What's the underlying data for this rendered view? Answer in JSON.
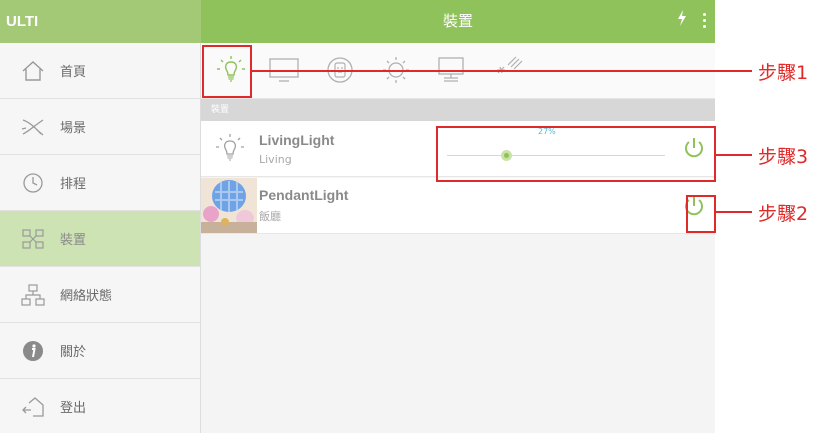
{
  "app": {
    "brand": "ULTI",
    "title": "裝置"
  },
  "topbar": {
    "flash_icon": "flash-icon",
    "more_icon": "more-vert-icon"
  },
  "sidebar": {
    "items": [
      {
        "label": "首頁",
        "icon": "home-icon"
      },
      {
        "label": "場景",
        "icon": "scene-icon"
      },
      {
        "label": "排程",
        "icon": "clock-icon"
      },
      {
        "label": "裝置",
        "icon": "devices-icon",
        "active": true
      },
      {
        "label": "網絡狀態",
        "icon": "network-icon"
      },
      {
        "label": "關於",
        "icon": "info-icon"
      },
      {
        "label": "登出",
        "icon": "logout-icon"
      }
    ]
  },
  "categories": [
    {
      "name": "light",
      "icon": "bulb-icon",
      "selected": true
    },
    {
      "name": "tv",
      "icon": "tv-icon"
    },
    {
      "name": "socket",
      "icon": "socket-icon"
    },
    {
      "name": "sun",
      "icon": "sun-icon"
    },
    {
      "name": "monitor",
      "icon": "monitor-icon"
    },
    {
      "name": "ac",
      "icon": "aircon-icon"
    }
  ],
  "section": {
    "label": "裝置"
  },
  "devices": [
    {
      "name": "LivingLight",
      "room": "Living",
      "icon": "bulb-icon",
      "dim_percent": 27,
      "dim_label": "27%"
    },
    {
      "name": "PendantLight",
      "room": "飯廳",
      "icon": "pendant-photo"
    }
  ],
  "annotations": {
    "step1": "步驟1",
    "step2": "步驟2",
    "step3": "步驟3",
    "color": "#e02a2a"
  },
  "colors": {
    "accent": "#8fc25a",
    "brand_bar": "#a3c977",
    "active_item": "#cde3b3"
  }
}
